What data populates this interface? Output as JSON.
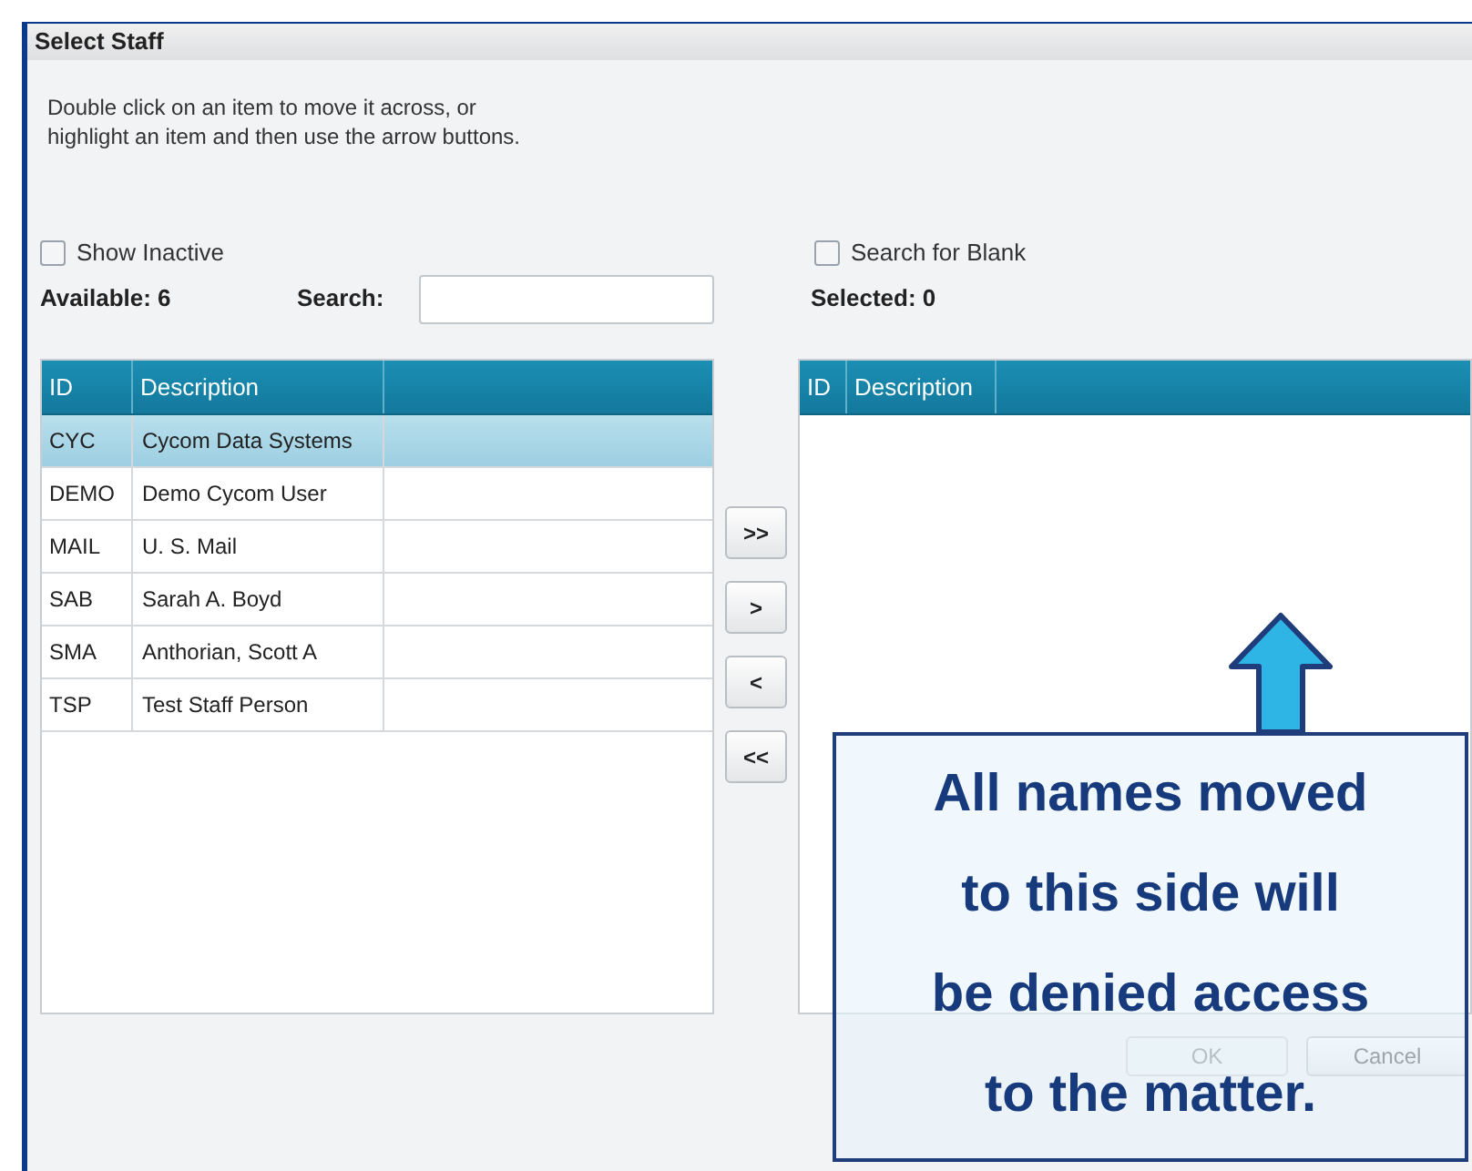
{
  "window": {
    "title": "Select Staff"
  },
  "instructions": "Double click on an item to move it across, or\nhighlight an item and then use the arrow buttons.",
  "available": {
    "show_inactive": {
      "label": "Show Inactive",
      "checked": false
    },
    "count_label": "Available: 6",
    "search": {
      "label": "Search:"
    },
    "table": {
      "columns": [
        "ID",
        "Description"
      ],
      "rows": [
        {
          "id": "CYC",
          "description": "Cycom Data Systems",
          "selected": true
        },
        {
          "id": "DEMO",
          "description": "Demo Cycom User",
          "selected": false
        },
        {
          "id": "MAIL",
          "description": "U. S. Mail",
          "selected": false
        },
        {
          "id": "SAB",
          "description": "Sarah A. Boyd",
          "selected": false
        },
        {
          "id": "SMA",
          "description": "Anthorian, Scott A",
          "selected": false
        },
        {
          "id": "TSP",
          "description": "Test Staff Person",
          "selected": false
        }
      ]
    }
  },
  "transfer_buttons": [
    ">>",
    ">",
    "<",
    "<<"
  ],
  "selected": {
    "search_for_blank": {
      "label": "Search for Blank",
      "checked": false
    },
    "count_label": "Selected: 0",
    "table": {
      "columns": [
        "ID",
        "Description"
      ]
    }
  },
  "buttons": [
    {
      "label": "OK",
      "disabled": true
    },
    {
      "label": "Cancel",
      "disabled": false
    }
  ],
  "callout": {
    "lines": [
      "All names moved",
      "to this side will",
      "be denied access",
      "to the matter."
    ]
  }
}
